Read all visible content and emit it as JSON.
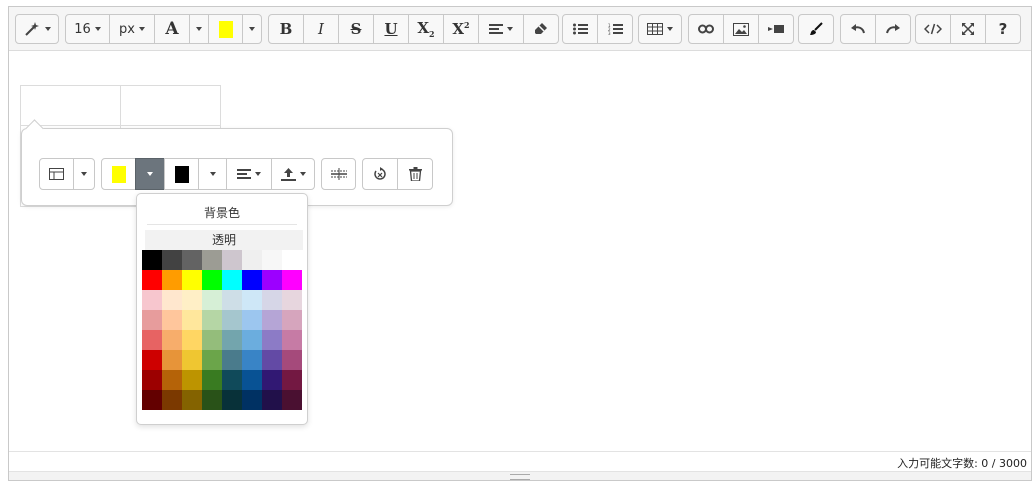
{
  "toolbar": {
    "style_icon": "magic-wand-icon",
    "font_size": "16",
    "font_unit": "px",
    "font_color_letter": "A",
    "highlight_color": "#ffff00",
    "bold": "B",
    "italic": "I",
    "strike": "S",
    "underline": "U",
    "subscript": "X",
    "superscript": "X"
  },
  "popover": {
    "bg_color": "#ffff00",
    "fg_color": "#000000"
  },
  "background_menu": {
    "title": "背景色",
    "transparent_label": "透明",
    "palette": [
      [
        "#000000",
        "#424242",
        "#636363",
        "#9c9c94",
        "#cec6ce",
        "#efefef",
        "#f7f7f7",
        "#ffffff"
      ],
      [
        "#ff0000",
        "#ff9c00",
        "#ffff00",
        "#00ff00",
        "#00ffff",
        "#0000ff",
        "#9c00ff",
        "#ff00ff"
      ],
      [
        "#f7c6ce",
        "#ffe7ce",
        "#ffefc6",
        "#d6efd6",
        "#cedee7",
        "#cee7f7",
        "#d6d6e7",
        "#e7d6de"
      ],
      [
        "#e79c9c",
        "#ffc69c",
        "#ffe79c",
        "#b5d6a5",
        "#a5c6ce",
        "#9cc6ef",
        "#b5a5d6",
        "#d6a5bd"
      ],
      [
        "#e76363",
        "#f7ad6b",
        "#ffd663",
        "#94bd7b",
        "#73a5ad",
        "#6badde",
        "#8c7bc6",
        "#c67ba5"
      ],
      [
        "#ce0000",
        "#e79439",
        "#efc631",
        "#6ba54a",
        "#4a7b8c",
        "#3984c6",
        "#634aa5",
        "#a54a7b"
      ],
      [
        "#9c0000",
        "#b56308",
        "#bd9400",
        "#397b21",
        "#104a5a",
        "#085294",
        "#311873",
        "#731842"
      ],
      [
        "#630000",
        "#7b3900",
        "#846300",
        "#295218",
        "#083139",
        "#003163",
        "#21104a",
        "#4a1031"
      ]
    ]
  },
  "status": {
    "counter": "入力可能文字数: 0 / 3000"
  }
}
